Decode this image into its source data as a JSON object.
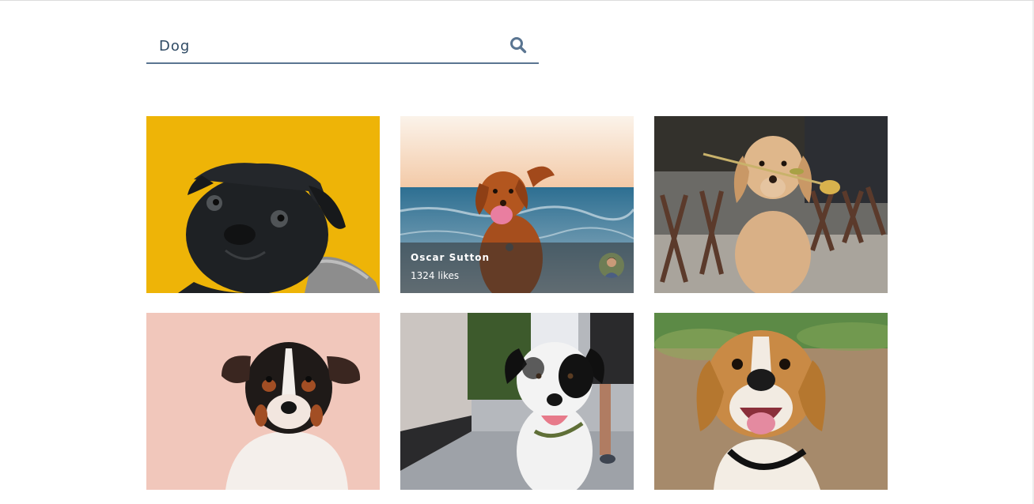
{
  "search": {
    "value": "Dog",
    "icon": "search-icon"
  },
  "photos": [
    {
      "subject": "pug on yellow background"
    },
    {
      "subject": "brown dog running on beach",
      "overlay": {
        "author": "Oscar Sutton",
        "likes": "1324 likes",
        "avatar": "avatar"
      }
    },
    {
      "subject": "golden retriever holding flower"
    },
    {
      "subject": "jack russell on pink background"
    },
    {
      "subject": "black and white dog on sidewalk"
    },
    {
      "subject": "smiling beagle"
    }
  ],
  "colors": {
    "search_underline": "#5a7591",
    "search_text": "#2f4a64",
    "overlay_bg": "rgba(45,45,45,0.55)"
  }
}
